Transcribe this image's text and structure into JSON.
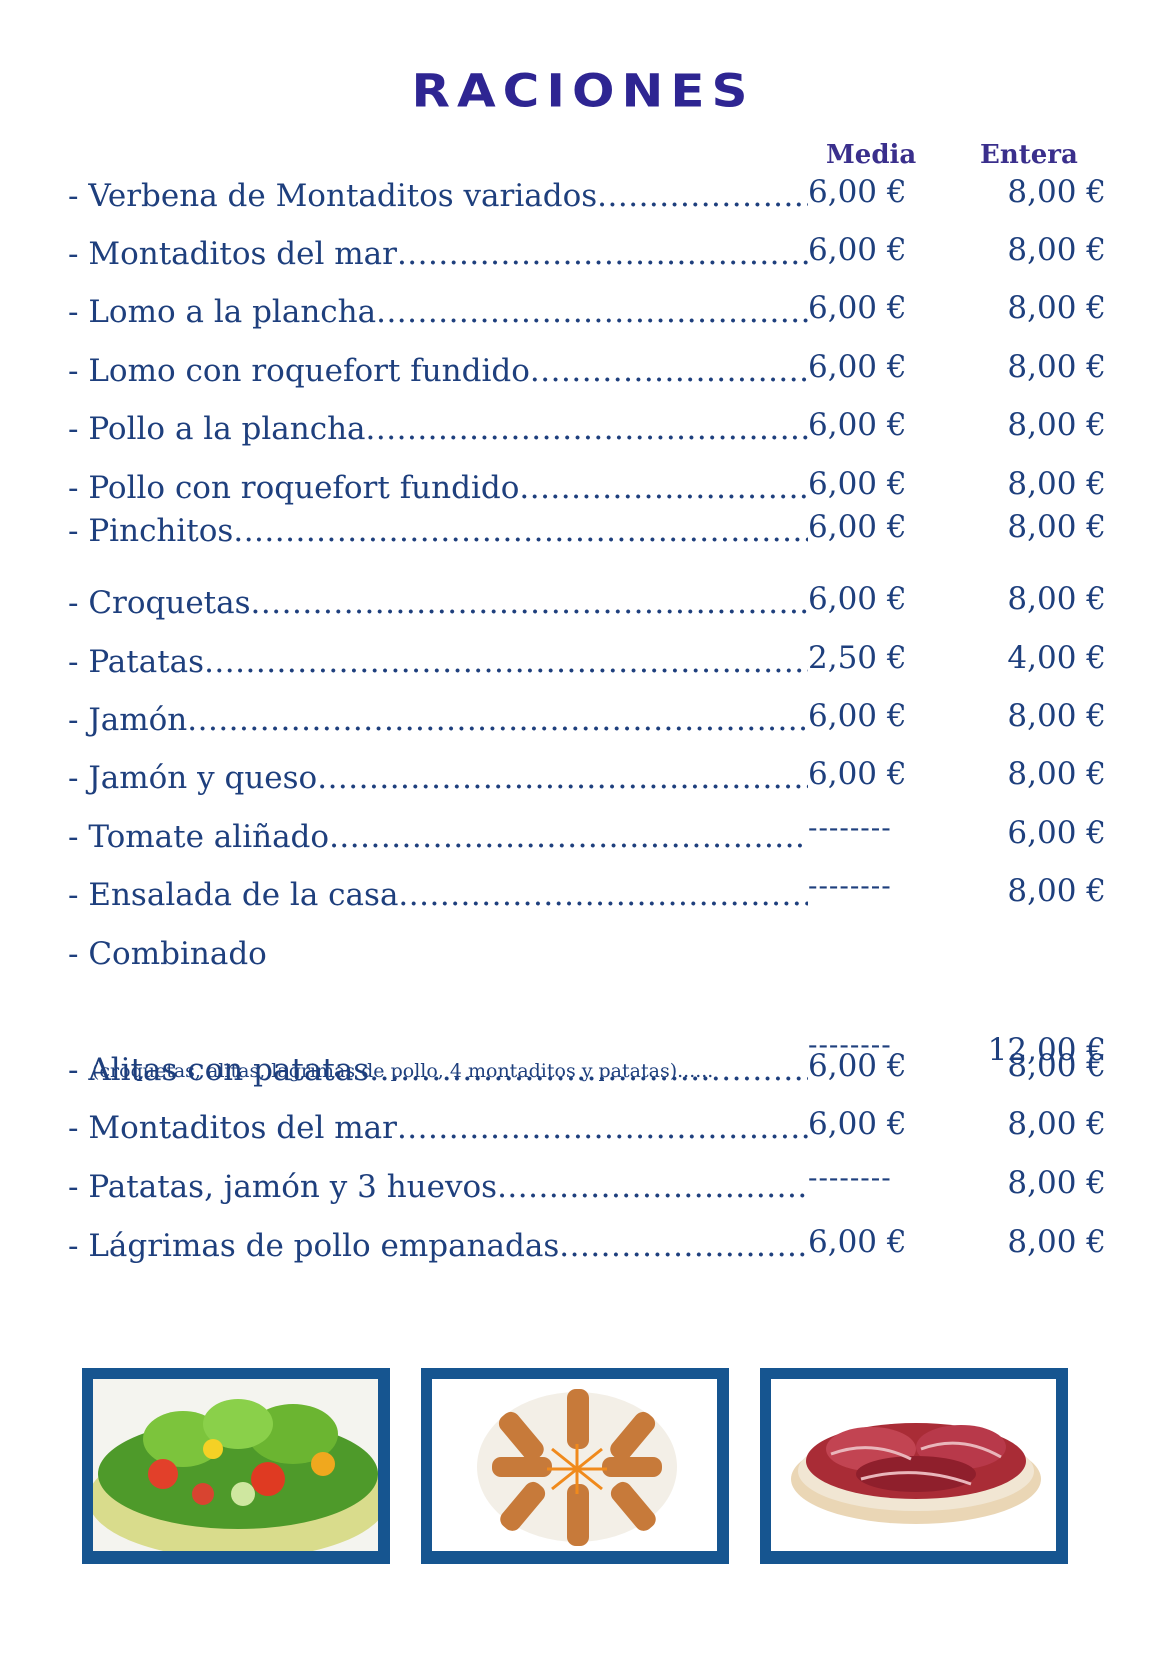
{
  "title": "RACIONES",
  "columns": {
    "media": "Media",
    "entera": "Entera"
  },
  "items": [
    {
      "name": "- Verbena de Montaditos variados",
      "media": "6,00 €",
      "entera": "8,00 €"
    },
    {
      "name": "- Montaditos del mar",
      "media": "6,00 €",
      "entera": "8,00 €"
    },
    {
      "name": "- Lomo a la plancha",
      "media": "6,00 €",
      "entera": "8,00 €"
    },
    {
      "name": "- Lomo con roquefort fundido",
      "media": "6,00 €",
      "entera": "8,00 €"
    },
    {
      "name": "- Pollo a la plancha",
      "media": "6,00 €",
      "entera": "8,00 €"
    },
    {
      "name": "- Pollo con roquefort fundido",
      "media": "6,00 €",
      "entera": "8,00 €"
    },
    {
      "name": "- Pinchitos",
      "media": "6,00 €",
      "entera": "8,00 €"
    },
    {
      "name": "- Croquetas",
      "media": "6,00 €",
      "entera": "8,00 €"
    },
    {
      "name": "- Patatas",
      "media": "2,50 €",
      "entera": "4,00 €"
    },
    {
      "name": "- Jamón",
      "media": "6,00 €",
      "entera": "8,00 €"
    },
    {
      "name": "- Jamón y queso",
      "media": "6,00 €",
      "entera": "8,00 €"
    },
    {
      "name": "- Tomate aliñado",
      "media": "--------",
      "entera": "6,00 €"
    },
    {
      "name": "- Ensalada de la casa",
      "media": "--------",
      "entera": "8,00 €"
    },
    {
      "name": "- Combinado",
      "media": "",
      "entera": ""
    },
    {
      "name": "- Alitas con patatas",
      "media": "6,00 €",
      "entera": "8,00 €"
    },
    {
      "name": "- Montaditos del mar",
      "media": "6,00 €",
      "entera": "8,00 €"
    },
    {
      "name": "- Patatas, jamón y 3 huevos",
      "media": "--------",
      "entera": "8,00 €"
    },
    {
      "name": "- Lágrimas de pollo empanadas",
      "media": "6,00 €",
      "entera": "8,00 €"
    }
  ],
  "combinado_detail": {
    "text": "(croquetas, alitas, lagrimas de pollo, 4 montaditos y patatas)",
    "media": "--------",
    "entera": "12,00 €"
  },
  "photos": [
    {
      "icon": "salad-photo"
    },
    {
      "icon": "skewers-photo"
    },
    {
      "icon": "ham-photo"
    }
  ],
  "colors": {
    "title": "#2e2592",
    "text": "#1e3f7d",
    "frame": "#165590"
  }
}
